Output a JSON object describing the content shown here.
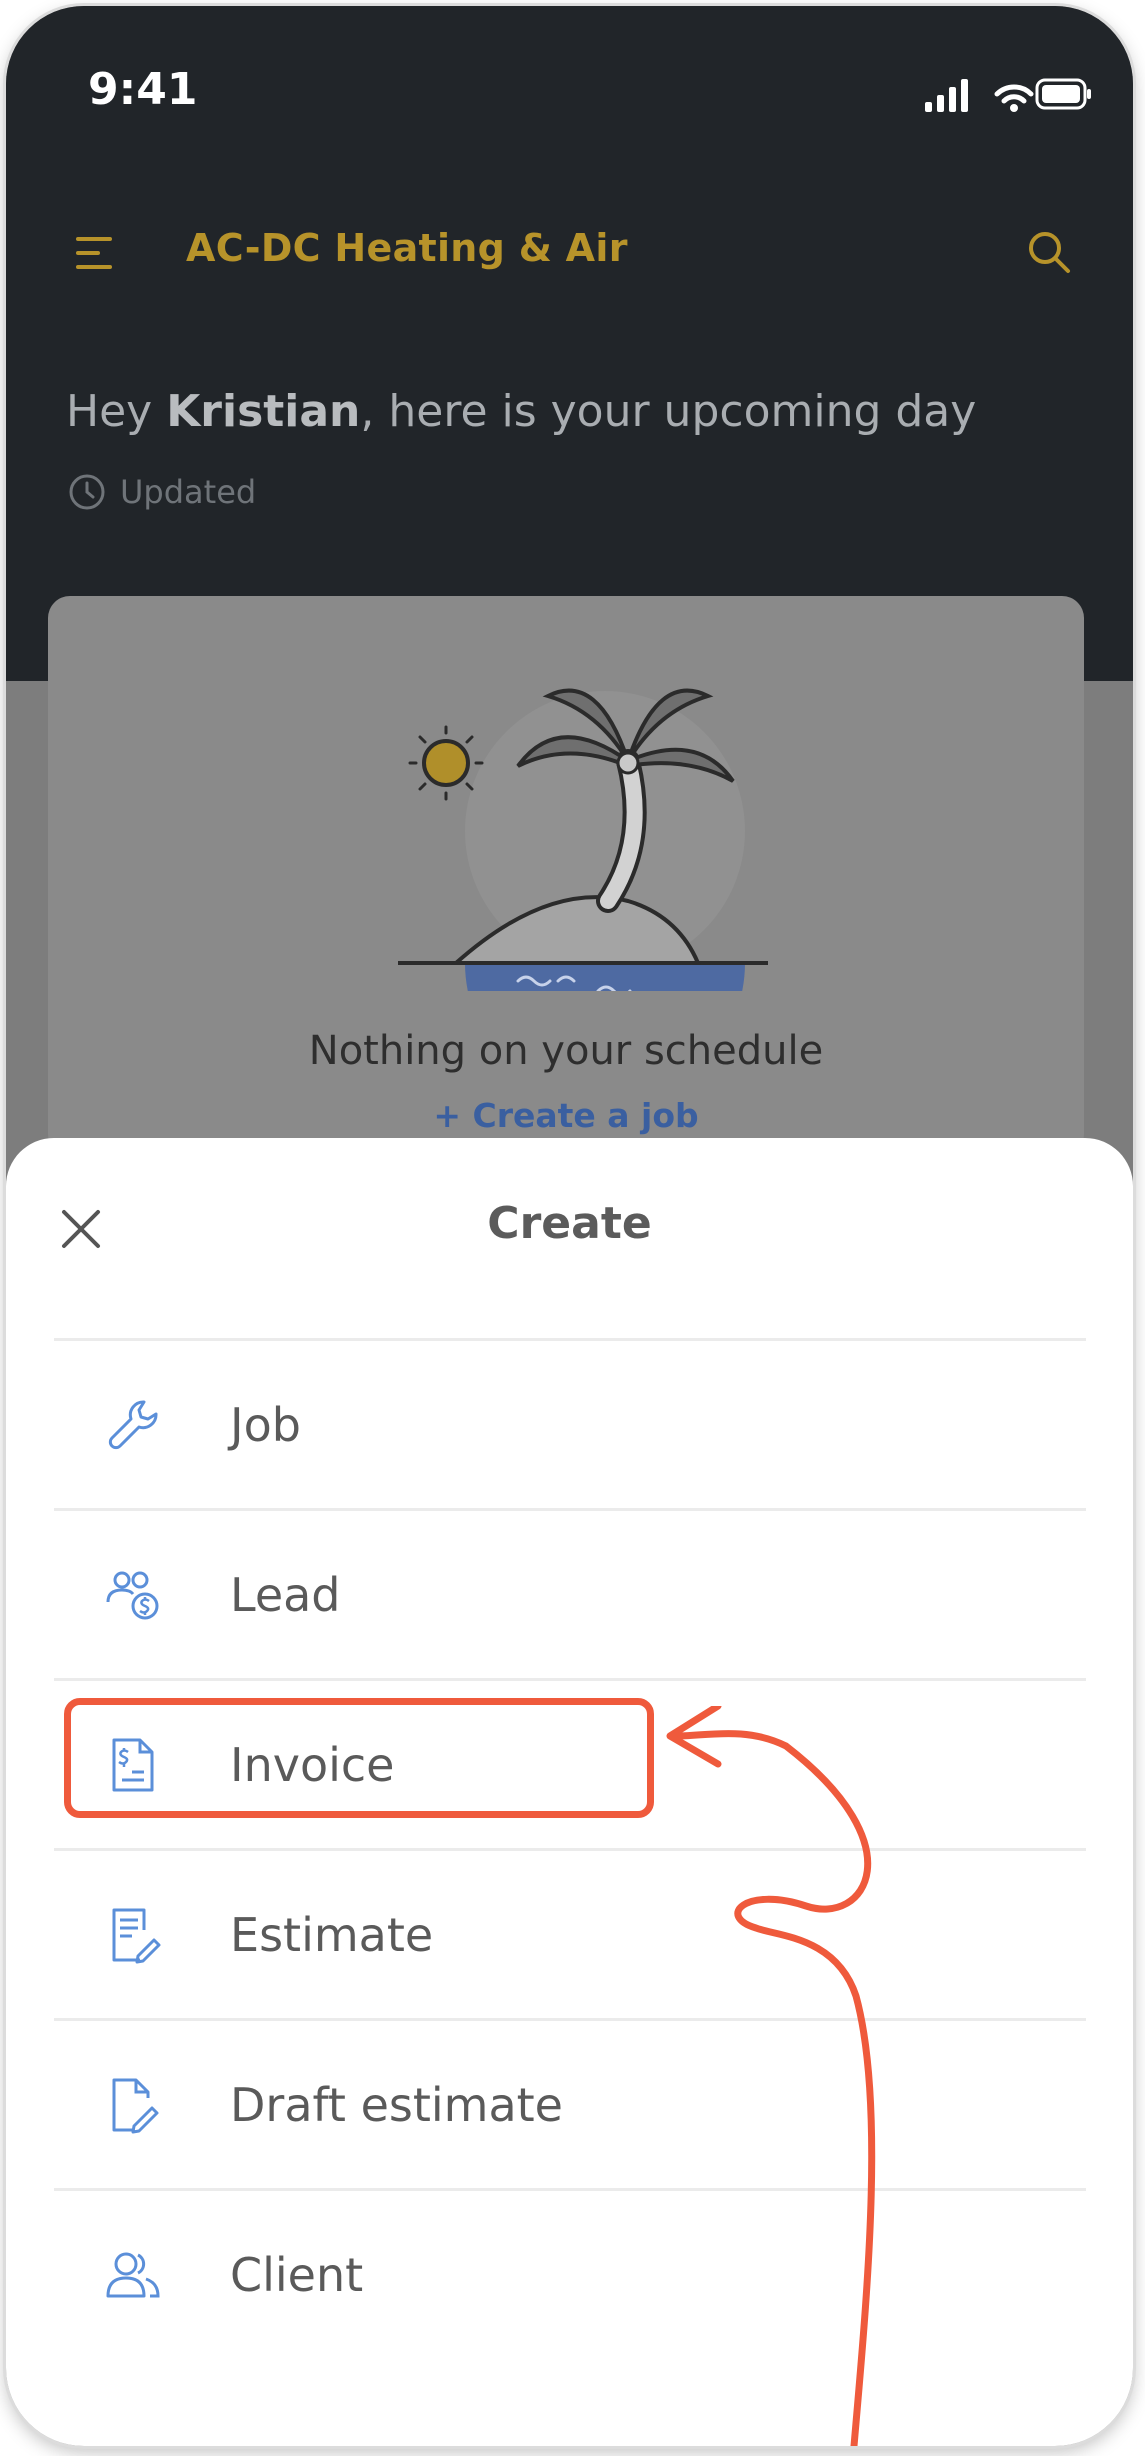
{
  "status_bar": {
    "time": "9:41"
  },
  "app_bar": {
    "title": "AC-DC Heating & Air",
    "menu_icon": "hamburger-menu-icon",
    "search_icon": "search-icon"
  },
  "greeting": {
    "prefix": "Hey ",
    "name": "Kristian",
    "suffix": ", here is your upcoming day",
    "updated_label": "Updated"
  },
  "schedule_card": {
    "empty_text": "Nothing on your schedule",
    "create_link": "+ Create a job"
  },
  "create_sheet": {
    "title": "Create",
    "items": [
      {
        "label": "Job",
        "icon": "wrench-icon"
      },
      {
        "label": "Lead",
        "icon": "users-dollar-icon"
      },
      {
        "label": "Invoice",
        "icon": "invoice-icon"
      },
      {
        "label": "Estimate",
        "icon": "estimate-icon"
      },
      {
        "label": "Draft estimate",
        "icon": "draft-estimate-icon"
      },
      {
        "label": "Client",
        "icon": "client-icon"
      }
    ]
  },
  "colors": {
    "header_bg": "#212529",
    "brand_gold": "#b7932a",
    "icon_blue": "#5b8fd9",
    "annotation_red": "#ef5a3c"
  }
}
